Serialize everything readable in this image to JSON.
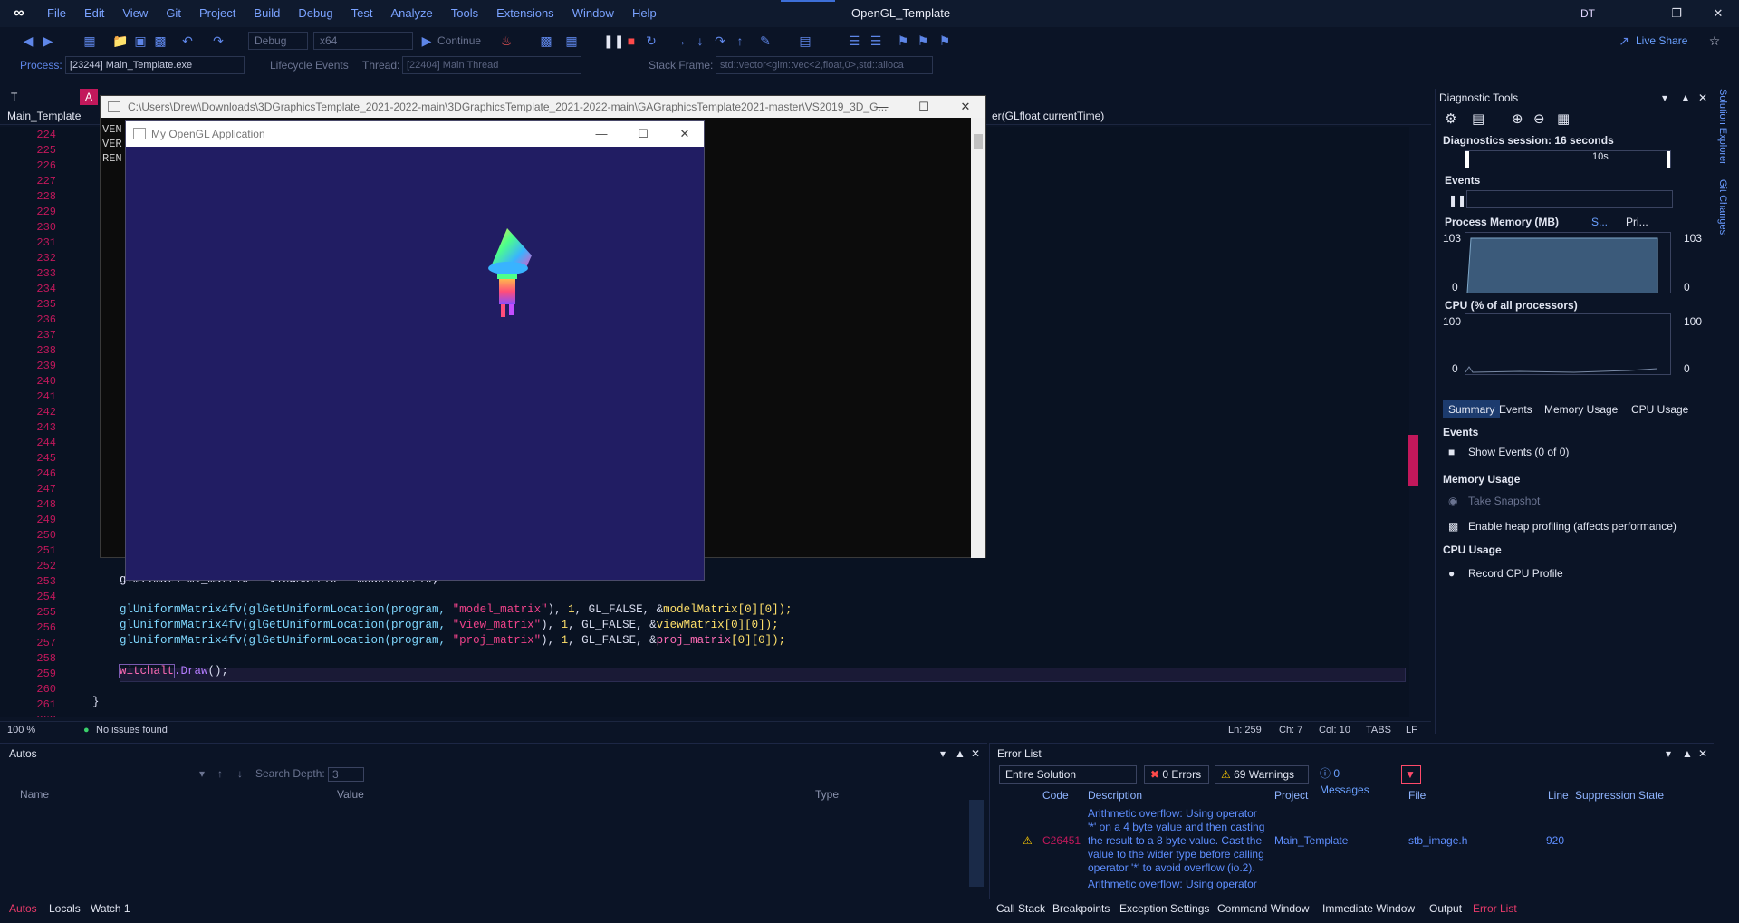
{
  "app": {
    "title": "OpenGL_Template",
    "avatar": "DT",
    "menu": [
      "File",
      "Edit",
      "View",
      "Git",
      "Project",
      "Build",
      "Debug",
      "Test",
      "Analyze",
      "Tools",
      "Extensions",
      "Window",
      "Help"
    ]
  },
  "toolbar": {
    "config": "Debug",
    "platform": "x64",
    "continue": "Continue",
    "live_share": "Live Share"
  },
  "procbar": {
    "process_label": "Process:",
    "process_value": "[23244] Main_Template.exe",
    "lifecycle": "Lifecycle Events",
    "thread_label": "Thread:",
    "thread_value": "[22404] Main Thread",
    "stack_label": "Stack Frame:",
    "stack_value": "std::vector<glm::vec<2,float,0>,std::alloca"
  },
  "editor": {
    "tabs": "TABS",
    "nav_file": "Main_Template",
    "nav_member": "er(GLfloat currentTime)",
    "line_numbers": [
      "224",
      "225",
      "226",
      "227",
      "228",
      "229",
      "230",
      "231",
      "232",
      "233",
      "234",
      "235",
      "236",
      "237",
      "238",
      "239",
      "240",
      "241",
      "242",
      "243",
      "244",
      "245",
      "246",
      "247",
      "248",
      "249",
      "250",
      "251",
      "252",
      "253",
      "254",
      "255",
      "256",
      "257",
      "258",
      "259",
      "260",
      "261",
      "262"
    ],
    "visible_top_lines": [
      "VEN",
      "VER",
      "REN"
    ],
    "line_253": "glm::mat4 mv_matrix = viewMatrix * modelMatrix;",
    "line_255": {
      "fn": "glUniformMatrix4fv(glGetUniformLocation(program, ",
      "str": "\"model_matrix\"",
      "rest": "), ",
      "num": "1",
      "mid": ", GL_FALSE, &",
      "var": "modelMatrix",
      "tail": "[0][0]);"
    },
    "line_256": {
      "fn": "glUniformMatrix4fv(glGetUniformLocation(program, ",
      "str": "\"view_matrix\"",
      "rest": "), ",
      "num": "1",
      "mid": ", GL_FALSE, &",
      "var": "viewMatrix",
      "tail": "[0][0]);"
    },
    "line_257": {
      "fn": "glUniformMatrix4fv(glGetUniformLocation(program, ",
      "str": "\"proj_matrix\"",
      "rest": "), ",
      "num": "1",
      "mid": ", GL_FALSE, &",
      "var": "proj_matrix",
      "tail": "[0][0]);"
    },
    "line_259": {
      "obj": "witchalt",
      "call": ".Draw",
      "tail": "();"
    },
    "line_261": "}",
    "zoom": "100 %",
    "issues": "No issues found",
    "ln": "Ln: 259",
    "ch": "Ch: 7",
    "col": "Col: 10",
    "eol": "LF"
  },
  "console": {
    "title": "C:\\Users\\Drew\\Downloads\\3DGraphicsTemplate_2021-2022-main\\3DGraphicsTemplate_2021-2022-main\\GAGraphicsTemplate2021-master\\VS2019_3D_G..."
  },
  "glapp": {
    "title": "My OpenGL Application"
  },
  "diagnostics": {
    "title": "Diagnostic Tools",
    "session": "Diagnostics session: 16 seconds",
    "timeline_mark": "10s",
    "events_label": "Events",
    "memory_label": "Process Memory (MB)",
    "memory_legend_1": "S...",
    "memory_legend_2": "Pri...",
    "memory_max": "103",
    "memory_min": "0",
    "cpu_label": "CPU (% of all processors)",
    "cpu_max": "100",
    "cpu_min": "0",
    "tabs": [
      "Summary",
      "Events",
      "Memory Usage",
      "CPU Usage"
    ],
    "sec_events": "Events",
    "show_events": "Show Events (0 of 0)",
    "sec_memory": "Memory Usage",
    "take_snapshot": "Take Snapshot",
    "heap_profiling": "Enable heap profiling (affects performance)",
    "sec_cpu": "CPU Usage",
    "record_cpu": "Record CPU Profile"
  },
  "side_tabs": [
    "Solution Explorer",
    "Git Changes"
  ],
  "autos": {
    "title": "Autos",
    "search_depth_label": "Search Depth:",
    "search_depth_value": "3",
    "columns": [
      "Name",
      "Value",
      "Type"
    ],
    "bottom_tabs": [
      "Autos",
      "Locals",
      "Watch 1"
    ]
  },
  "errors": {
    "title": "Error List",
    "scope": "Entire Solution",
    "errors_btn": "0 Errors",
    "warnings_btn": "69 Warnings",
    "messages_btn": "0 Messages",
    "columns": [
      "Code",
      "Description",
      "Project",
      "File",
      "Line",
      "Suppression State"
    ],
    "row": {
      "code": "C26451",
      "description": "Arithmetic overflow: Using operator '*' on a 4 byte value and then casting the result to a 8 byte value. Cast the value to the wider type before calling operator '*' to avoid overflow (io.2).",
      "project": "Main_Template",
      "file": "stb_image.h",
      "line": "920"
    },
    "next_row_desc": "Arithmetic overflow: Using operator",
    "bottom_tabs": [
      "Call Stack",
      "Breakpoints",
      "Exception Settings",
      "Command Window",
      "Immediate Window",
      "Output",
      "Error List"
    ]
  },
  "colors": {
    "accent": "#3d6fd8",
    "line_number": "#c2185b",
    "gl_background": "#211d63"
  }
}
